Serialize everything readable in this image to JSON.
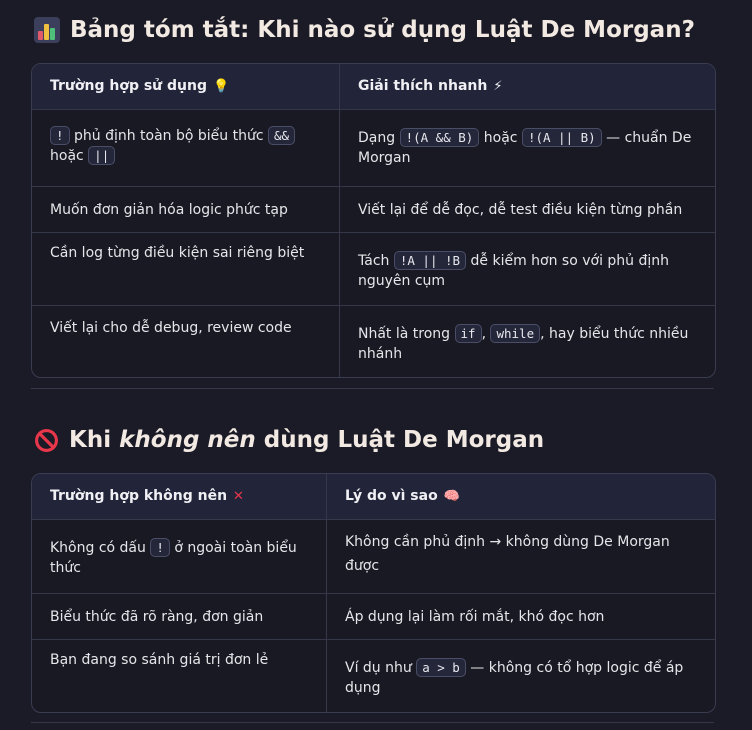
{
  "section1": {
    "title": "Bảng tóm tắt: Khi nào sử dụng Luật De Morgan?",
    "icon": "bar-chart-icon",
    "headers": [
      "Trường hợp sử dụng",
      "Giải thích nhanh"
    ],
    "header_icons": [
      "lightbulb-icon",
      "lightning-icon"
    ],
    "rows": [
      {
        "c1_parts": [
          "!",
          " phủ định toàn bộ biểu thức ",
          "&&",
          " hoặc ",
          "||"
        ],
        "c2_parts": [
          "Dạng ",
          "!(A && B)",
          " hoặc ",
          "!(A || B)",
          " — chuẩn De Morgan"
        ]
      },
      {
        "c1": "Muốn đơn giản hóa logic phức tạp",
        "c2": "Viết lại để dễ đọc, dễ test điều kiện từng phần"
      },
      {
        "c1": "Cần log từng điều kiện sai riêng biệt",
        "c2_parts": [
          "Tách ",
          "!A || !B",
          " dễ kiểm hơn so với phủ định nguyên cụm"
        ]
      },
      {
        "c1": "Viết lại cho dễ debug, review code",
        "c2_parts": [
          "Nhất là trong ",
          "if",
          ", ",
          "while",
          ", hay biểu thức nhiều nhánh"
        ]
      }
    ]
  },
  "section2": {
    "title_pre": "Khi ",
    "title_em": "không nên",
    "title_post": " dùng Luật De Morgan",
    "icon": "prohibited-icon",
    "headers": [
      "Trường hợp không nên",
      "Lý do vì sao"
    ],
    "header_icons": [
      "cross-mark-icon",
      "brain-icon"
    ],
    "rows": [
      {
        "c1_parts": [
          "Không có dấu ",
          "!",
          " ở ngoài toàn biểu thức"
        ],
        "c2": "Không cần phủ định → không dùng De Morgan được"
      },
      {
        "c1": "Biểu thức đã rõ ràng, đơn giản",
        "c2": "Áp dụng lại làm rối mắt, khó đọc hơn"
      },
      {
        "c1": "Bạn đang so sánh giá trị đơn lẻ",
        "c2_parts": [
          "Ví dụ như ",
          "a > b",
          " — không có tổ hợp logic để áp dụng"
        ]
      }
    ]
  }
}
